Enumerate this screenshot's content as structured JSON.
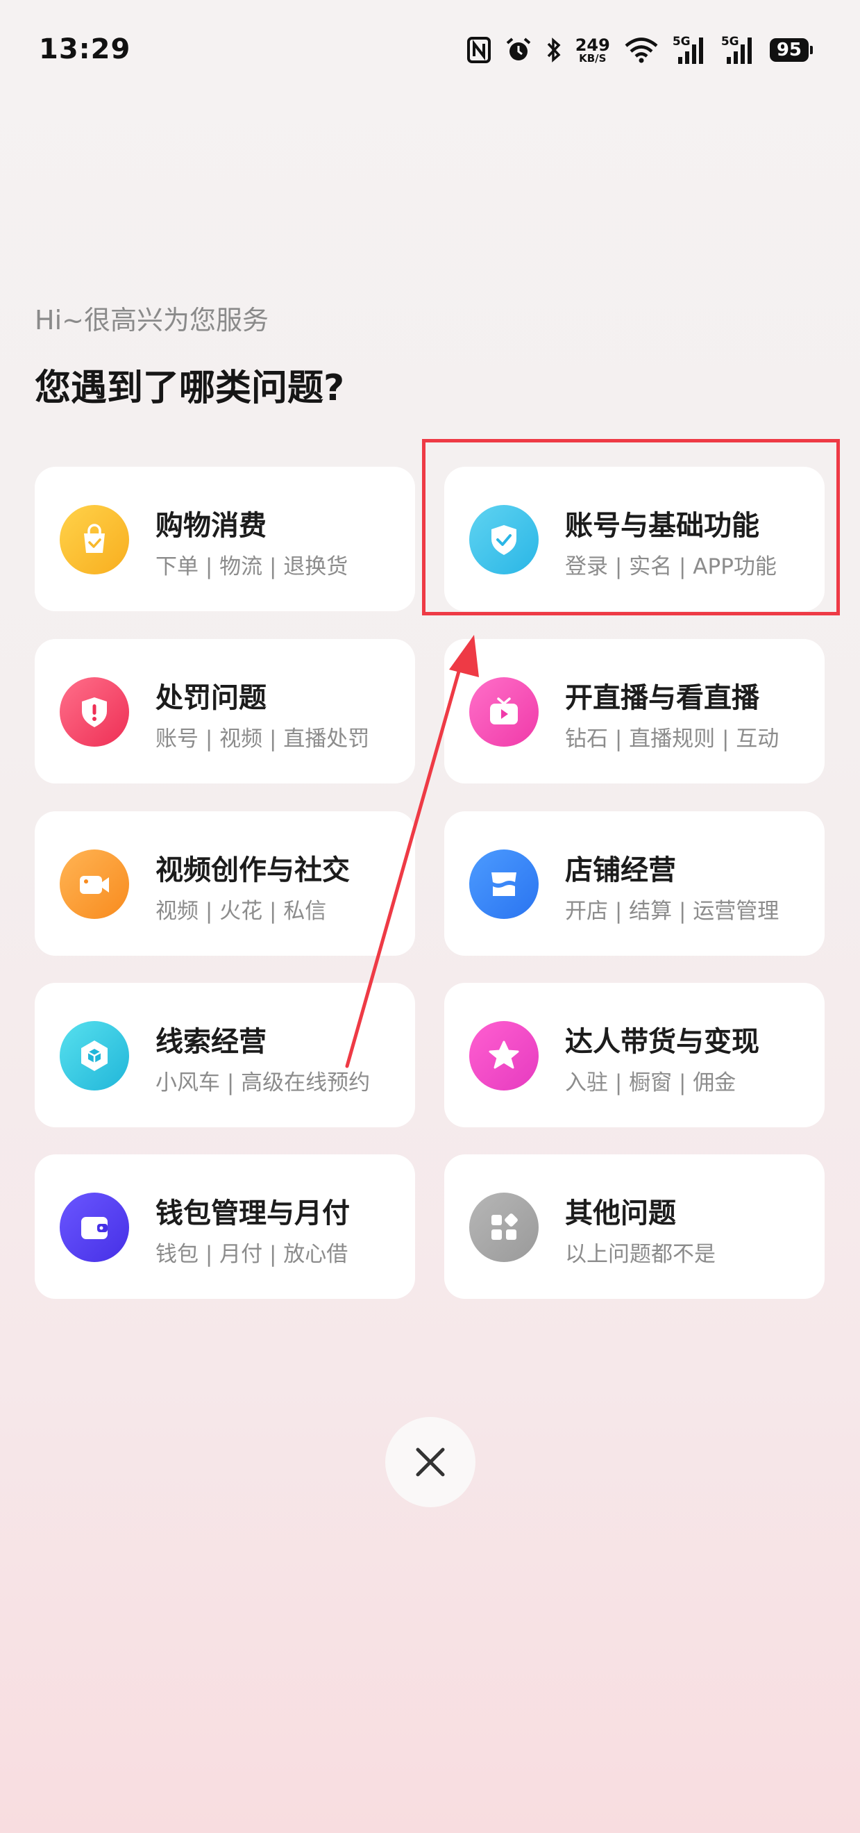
{
  "status_bar": {
    "time": "13:29",
    "net_speed": "249",
    "net_speed_unit": "KB/S",
    "signal1_label": "5G",
    "signal2_label": "5G",
    "battery": "95"
  },
  "header": {
    "greeting": "Hi~很高兴为您服务",
    "question": "您遇到了哪类问题?"
  },
  "categories": [
    {
      "title": "购物消费",
      "subtitle": "下单 | 物流 | 退换货",
      "icon": "shopping-bag-icon",
      "color": "#f8ae1f"
    },
    {
      "title": "账号与基础功能",
      "subtitle": "登录 | 实名 | APP功能",
      "icon": "shield-check-icon",
      "color": "#2ab6e6"
    },
    {
      "title": "处罚问题",
      "subtitle": "账号 | 视频 | 直播处罚",
      "icon": "shield-alert-icon",
      "color": "#ee2f55"
    },
    {
      "title": "开直播与看直播",
      "subtitle": "钻石 | 直播规则 | 互动",
      "icon": "tv-play-icon",
      "color": "#f03aa9"
    },
    {
      "title": "视频创作与社交",
      "subtitle": "视频 | 火花 | 私信",
      "icon": "video-camera-icon",
      "color": "#f88b1e"
    },
    {
      "title": "店铺经营",
      "subtitle": "开店 | 结算 | 运营管理",
      "icon": "store-icon",
      "color": "#2a74f0"
    },
    {
      "title": "线索经营",
      "subtitle": "小风车 | 高级在线预约",
      "icon": "cube-icon",
      "color": "#21b6d9"
    },
    {
      "title": "达人带货与变现",
      "subtitle": "入驻 | 橱窗 | 佣金",
      "icon": "star-icon",
      "color": "#e63bc0"
    },
    {
      "title": "钱包管理与月付",
      "subtitle": "钱包 | 月付 | 放心借",
      "icon": "wallet-icon",
      "color": "#4630e6"
    },
    {
      "title": "其他问题",
      "subtitle": "以上问题都不是",
      "icon": "apps-grid-icon",
      "color": "#9a9a9a"
    }
  ],
  "annotation": {
    "highlight_color": "#ee3a45"
  },
  "close_button": {
    "icon": "close-icon"
  }
}
